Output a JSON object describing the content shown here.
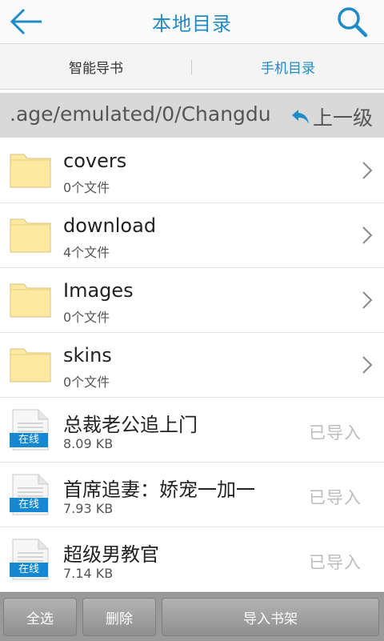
{
  "header": {
    "title": "本地目录"
  },
  "tabs": [
    {
      "label": "智能导书"
    },
    {
      "label": "手机目录"
    }
  ],
  "pathbar": {
    "path": ".age/emulated/0/Changdu",
    "up_label": "上一级"
  },
  "folders": [
    {
      "name": "covers",
      "count": "0个文件"
    },
    {
      "name": "download",
      "count": "4个文件"
    },
    {
      "name": "Images",
      "count": "0个文件"
    },
    {
      "name": "skins",
      "count": "0个文件"
    }
  ],
  "files": [
    {
      "name": "总裁老公追上门",
      "size": "8.09 KB",
      "badge": "在线",
      "status": "已导入"
    },
    {
      "name": "首席追妻：娇宠一加一",
      "size": "7.93 KB",
      "badge": "在线",
      "status": "已导入"
    },
    {
      "name": "超级男教官",
      "size": "7.14 KB",
      "badge": "在线",
      "status": "已导入"
    }
  ],
  "bottom": {
    "select_all": "全选",
    "delete": "删除",
    "import": "导入书架"
  },
  "colors": {
    "accent": "#1f8bc9",
    "badge": "#1588d1",
    "folder": "#fde9a2"
  },
  "icons": [
    "back-arrow-icon",
    "search-icon",
    "return-arrow-icon",
    "folder-icon",
    "document-icon",
    "chevron-right-icon"
  ]
}
